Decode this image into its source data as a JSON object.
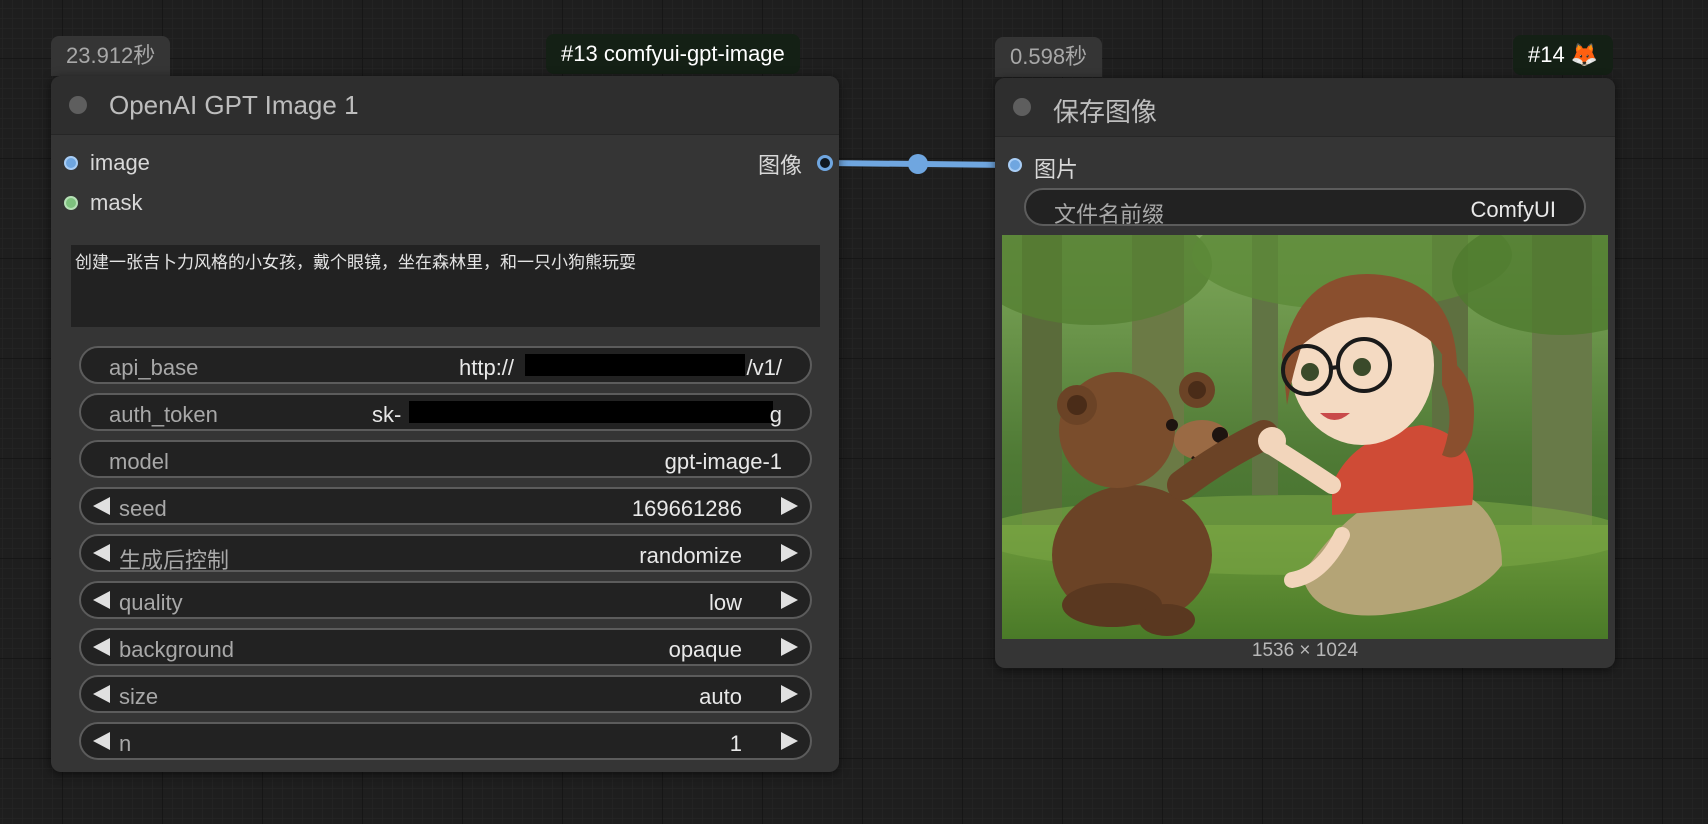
{
  "node13": {
    "timing": "23.912秒",
    "id_badge": "#13 comfyui-gpt-image",
    "title": "OpenAI GPT Image 1",
    "inputs": [
      {
        "label": "image",
        "color": "#6fa6e0"
      },
      {
        "label": "mask",
        "color": "#7ec27e"
      }
    ],
    "output_label": "图像",
    "prompt": "创建一张吉卜力风格的小女孩，戴个眼镜，坐在森林里，和一只小狗熊玩耍",
    "widgets": {
      "api_base": {
        "label": "api_base",
        "value_prefix": "http://",
        "value_suffix": "/v1/"
      },
      "auth_token": {
        "label": "auth_token",
        "value_prefix": "sk-",
        "value_suffix": "g"
      },
      "model": {
        "label": "model",
        "value": "gpt-image-1"
      },
      "seed": {
        "label": "seed",
        "value": "169661286"
      },
      "control_after_generate": {
        "label": "生成后控制",
        "value": "randomize"
      },
      "quality": {
        "label": "quality",
        "value": "low"
      },
      "background": {
        "label": "background",
        "value": "opaque"
      },
      "size": {
        "label": "size",
        "value": "auto"
      },
      "n": {
        "label": "n",
        "value": "1"
      }
    }
  },
  "node14": {
    "timing": "0.598秒",
    "id_badge": "#14 🦊",
    "title": "保存图像",
    "input_label": "图片",
    "filename_prefix": {
      "label": "文件名前缀",
      "value": "ComfyUI"
    },
    "image_size_text": "1536 × 1024"
  },
  "colors": {
    "canvas_bg": "#1e1e1e",
    "node_body": "#353535",
    "node_title": "#2e2e2e",
    "link": "#6fa6e0",
    "id_badge_bg": "#142015"
  }
}
